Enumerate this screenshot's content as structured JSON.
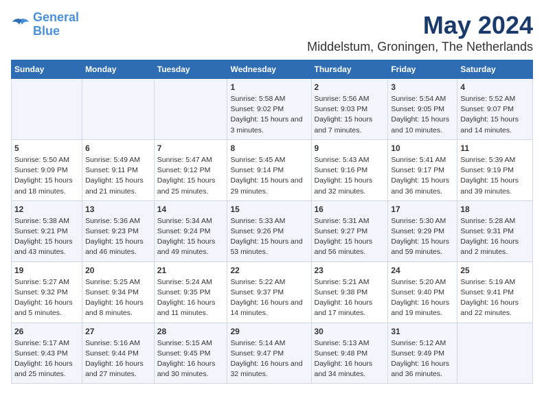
{
  "logo": {
    "line1": "General",
    "line2": "Blue"
  },
  "title": "May 2024",
  "subtitle": "Middelstum, Groningen, The Netherlands",
  "weekdays": [
    "Sunday",
    "Monday",
    "Tuesday",
    "Wednesday",
    "Thursday",
    "Friday",
    "Saturday"
  ],
  "weeks": [
    [
      {
        "day": "",
        "info": ""
      },
      {
        "day": "",
        "info": ""
      },
      {
        "day": "",
        "info": ""
      },
      {
        "day": "1",
        "info": "Sunrise: 5:58 AM\nSunset: 9:02 PM\nDaylight: 15 hours\nand 3 minutes."
      },
      {
        "day": "2",
        "info": "Sunrise: 5:56 AM\nSunset: 9:03 PM\nDaylight: 15 hours\nand 7 minutes."
      },
      {
        "day": "3",
        "info": "Sunrise: 5:54 AM\nSunset: 9:05 PM\nDaylight: 15 hours\nand 10 minutes."
      },
      {
        "day": "4",
        "info": "Sunrise: 5:52 AM\nSunset: 9:07 PM\nDaylight: 15 hours\nand 14 minutes."
      }
    ],
    [
      {
        "day": "5",
        "info": "Sunrise: 5:50 AM\nSunset: 9:09 PM\nDaylight: 15 hours\nand 18 minutes."
      },
      {
        "day": "6",
        "info": "Sunrise: 5:49 AM\nSunset: 9:11 PM\nDaylight: 15 hours\nand 21 minutes."
      },
      {
        "day": "7",
        "info": "Sunrise: 5:47 AM\nSunset: 9:12 PM\nDaylight: 15 hours\nand 25 minutes."
      },
      {
        "day": "8",
        "info": "Sunrise: 5:45 AM\nSunset: 9:14 PM\nDaylight: 15 hours\nand 29 minutes."
      },
      {
        "day": "9",
        "info": "Sunrise: 5:43 AM\nSunset: 9:16 PM\nDaylight: 15 hours\nand 32 minutes."
      },
      {
        "day": "10",
        "info": "Sunrise: 5:41 AM\nSunset: 9:17 PM\nDaylight: 15 hours\nand 36 minutes."
      },
      {
        "day": "11",
        "info": "Sunrise: 5:39 AM\nSunset: 9:19 PM\nDaylight: 15 hours\nand 39 minutes."
      }
    ],
    [
      {
        "day": "12",
        "info": "Sunrise: 5:38 AM\nSunset: 9:21 PM\nDaylight: 15 hours\nand 43 minutes."
      },
      {
        "day": "13",
        "info": "Sunrise: 5:36 AM\nSunset: 9:23 PM\nDaylight: 15 hours\nand 46 minutes."
      },
      {
        "day": "14",
        "info": "Sunrise: 5:34 AM\nSunset: 9:24 PM\nDaylight: 15 hours\nand 49 minutes."
      },
      {
        "day": "15",
        "info": "Sunrise: 5:33 AM\nSunset: 9:26 PM\nDaylight: 15 hours\nand 53 minutes."
      },
      {
        "day": "16",
        "info": "Sunrise: 5:31 AM\nSunset: 9:27 PM\nDaylight: 15 hours\nand 56 minutes."
      },
      {
        "day": "17",
        "info": "Sunrise: 5:30 AM\nSunset: 9:29 PM\nDaylight: 15 hours\nand 59 minutes."
      },
      {
        "day": "18",
        "info": "Sunrise: 5:28 AM\nSunset: 9:31 PM\nDaylight: 16 hours\nand 2 minutes."
      }
    ],
    [
      {
        "day": "19",
        "info": "Sunrise: 5:27 AM\nSunset: 9:32 PM\nDaylight: 16 hours\nand 5 minutes."
      },
      {
        "day": "20",
        "info": "Sunrise: 5:25 AM\nSunset: 9:34 PM\nDaylight: 16 hours\nand 8 minutes."
      },
      {
        "day": "21",
        "info": "Sunrise: 5:24 AM\nSunset: 9:35 PM\nDaylight: 16 hours\nand 11 minutes."
      },
      {
        "day": "22",
        "info": "Sunrise: 5:22 AM\nSunset: 9:37 PM\nDaylight: 16 hours\nand 14 minutes."
      },
      {
        "day": "23",
        "info": "Sunrise: 5:21 AM\nSunset: 9:38 PM\nDaylight: 16 hours\nand 17 minutes."
      },
      {
        "day": "24",
        "info": "Sunrise: 5:20 AM\nSunset: 9:40 PM\nDaylight: 16 hours\nand 19 minutes."
      },
      {
        "day": "25",
        "info": "Sunrise: 5:19 AM\nSunset: 9:41 PM\nDaylight: 16 hours\nand 22 minutes."
      }
    ],
    [
      {
        "day": "26",
        "info": "Sunrise: 5:17 AM\nSunset: 9:43 PM\nDaylight: 16 hours\nand 25 minutes."
      },
      {
        "day": "27",
        "info": "Sunrise: 5:16 AM\nSunset: 9:44 PM\nDaylight: 16 hours\nand 27 minutes."
      },
      {
        "day": "28",
        "info": "Sunrise: 5:15 AM\nSunset: 9:45 PM\nDaylight: 16 hours\nand 30 minutes."
      },
      {
        "day": "29",
        "info": "Sunrise: 5:14 AM\nSunset: 9:47 PM\nDaylight: 16 hours\nand 32 minutes."
      },
      {
        "day": "30",
        "info": "Sunrise: 5:13 AM\nSunset: 9:48 PM\nDaylight: 16 hours\nand 34 minutes."
      },
      {
        "day": "31",
        "info": "Sunrise: 5:12 AM\nSunset: 9:49 PM\nDaylight: 16 hours\nand 36 minutes."
      },
      {
        "day": "",
        "info": ""
      }
    ]
  ]
}
